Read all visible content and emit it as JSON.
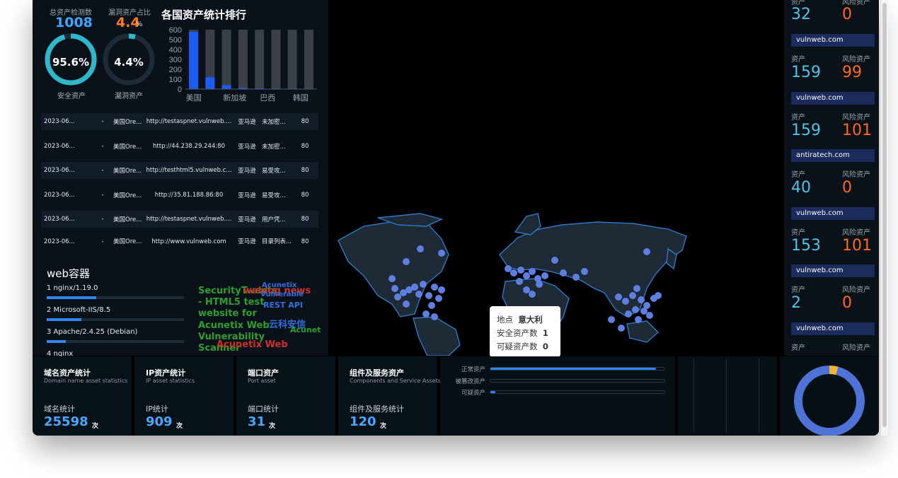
{
  "kpis": {
    "total_label": "总资产检测数",
    "total_value": "1008",
    "vuln_ratio_label": "漏洞资产占比",
    "vuln_ratio_value": "4.4",
    "vuln_ratio_unit": "%",
    "safe_ring_text": "95.6%",
    "safe_ring_label": "安全资产",
    "safe_ring_fraction": 0.956,
    "vuln_ring_text": "4.4%",
    "vuln_ring_label": "漏洞资产",
    "vuln_ring_fraction": 0.044
  },
  "country_chart": {
    "title": "各国资产统计排行",
    "chart_data": {
      "type": "bar",
      "title": "各国资产统计排行",
      "categories": [
        "美国",
        "",
        "新加坡",
        "",
        "巴西",
        "",
        "韩国",
        ""
      ],
      "tick_labels_shown": [
        "美国",
        "新加坡",
        "巴西",
        "韩国"
      ],
      "series": [
        {
          "values": [
            580,
            120,
            40,
            12,
            8,
            6,
            5,
            4
          ]
        }
      ],
      "background_max": 600,
      "ylim": [
        0,
        600
      ],
      "yticks": [
        0,
        100,
        200,
        300,
        400,
        500,
        600
      ]
    }
  },
  "asset_table": {
    "rows": [
      [
        "2023-06...",
        "-",
        "美国Ore...",
        "http://testaspnet.vulnweb....",
        "亚马逊",
        "未加密...",
        "80"
      ],
      [
        "2023-06...",
        "-",
        "美国Ore...",
        "http://44.238.29.244:80",
        "亚马逊",
        "未加密...",
        "80"
      ],
      [
        "2023-06...",
        "-",
        "美国Ore...",
        "http://testhtml5.vulnweb.c...",
        "亚马逊",
        "易受攻...",
        "80"
      ],
      [
        "2023-06...",
        "-",
        "美国Ore...",
        "http://35.81.188.86:80",
        "亚马逊",
        "易受攻...",
        "80"
      ],
      [
        "2023-06...",
        "-",
        "美国Ore...",
        "http://testaspnet.vulnweb....",
        "亚马逊",
        "用户凭...",
        "80"
      ],
      [
        "2023-06...",
        "-",
        "美国Ore...",
        "http://www.vulnweb.com",
        "亚马逊",
        "目录列表...",
        "80"
      ]
    ]
  },
  "web_container": {
    "title": "web容器",
    "items": [
      {
        "label": "1  nginx/1.19.0",
        "fraction": 0.36
      },
      {
        "label": "2  Microsoft-IIS/8.5",
        "fraction": 0.25
      },
      {
        "label": "3  Apache/2.4.25 (Debian)",
        "fraction": 0.14
      },
      {
        "label": "4  nginx",
        "fraction": 0.1
      }
    ]
  },
  "word_cloud": [
    {
      "text": "SecurityTweets",
      "color": "#2e9e2e"
    },
    {
      "text": "- HTML5 test",
      "color": "#2e9e2e"
    },
    {
      "text": "website for",
      "color": "#2e9e2e"
    },
    {
      "text": "Acunetix Web",
      "color": "#2e9e2e"
    },
    {
      "text": "Vulnerability",
      "color": "#2e9e2e"
    },
    {
      "text": "Scanner",
      "color": "#2e9e2e"
    },
    {
      "text": "weblog news",
      "color": "#d0302a"
    },
    {
      "text": "Acunetix",
      "color": "#2f6fe0"
    },
    {
      "text": "Vulnerable",
      "color": "#2f6fe0"
    },
    {
      "text": "REST API",
      "color": "#2f6fe0"
    },
    {
      "text": "云科安信",
      "color": "#2f6fe0"
    },
    {
      "text": "Acunetix Web",
      "color": "#d0302a"
    },
    {
      "text": "Acunet",
      "color": "#2e9e2e"
    }
  ],
  "map_tooltip": {
    "location_label": "地点",
    "location_value": "意大利",
    "safe_label": "安全资产数",
    "safe_value": "1",
    "suspect_label": "可疑资产数",
    "suspect_value": "0"
  },
  "right_panel": {
    "top": {
      "asset_label": "资产",
      "risk_label": "风险资产",
      "asset": "32",
      "risk": "0"
    },
    "items": [
      {
        "domain": "vulnweb.com",
        "asset_label": "资产",
        "risk_label": "风险资产",
        "asset": "159",
        "risk": "99"
      },
      {
        "domain": "vulnweb.com",
        "asset_label": "资产",
        "risk_label": "风险资产",
        "asset": "159",
        "risk": "101"
      },
      {
        "domain": "antiratech.com",
        "asset_label": "资产",
        "risk_label": "风险资产",
        "asset": "40",
        "risk": "0"
      },
      {
        "domain": "vulnweb.com",
        "asset_label": "资产",
        "risk_label": "风险资产",
        "asset": "153",
        "risk": "101"
      },
      {
        "domain": "vulnweb.com",
        "asset_label": "资产",
        "risk_label": "风险资产",
        "asset": "2",
        "risk": "0"
      },
      {
        "domain": "vulnweb.com",
        "asset_label": "资产",
        "risk_label": "风险资产",
        "asset": "",
        "risk": ""
      }
    ],
    "colors": {
      "asset": "#4fc3e6",
      "risk": "#ff6a1a"
    }
  },
  "bottom_cards": [
    {
      "title": "域名资产统计",
      "subtitle": "Domain name asset statistics",
      "stat_label": "域名统计",
      "value": "25598",
      "unit": "次"
    },
    {
      "title": "IP资产统计",
      "subtitle": "IP asset statistics",
      "stat_label": "IP统计",
      "value": "909",
      "unit": "次"
    },
    {
      "title": "端口资产",
      "subtitle": "Port asset",
      "stat_label": "端口统计",
      "value": "31",
      "unit": "次"
    },
    {
      "title": "组件及服务资产",
      "subtitle": "Components and Service Assets",
      "stat_label": "组件及服务统计",
      "value": "120",
      "unit": "次"
    }
  ],
  "asset_status": [
    {
      "label": "正常资产",
      "fraction": 0.95
    },
    {
      "label": "被篡改资产",
      "fraction": 0.0
    },
    {
      "label": "可疑资产",
      "fraction": 0.03
    }
  ],
  "donut": {
    "main_color": "#4f72d6",
    "accent_color": "#f0b43c",
    "accent_fraction": 0.04
  }
}
